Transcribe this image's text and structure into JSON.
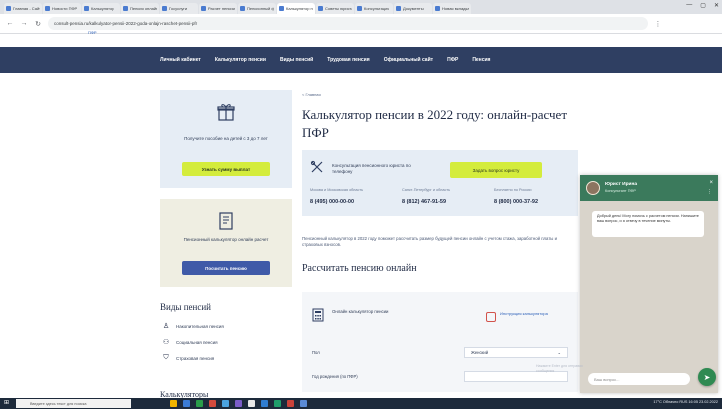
{
  "browser": {
    "tabs": [
      {
        "title": "Главная - Сайт"
      },
      {
        "title": "Новости ПФР"
      },
      {
        "title": "Калькулятор"
      },
      {
        "title": "Пенсия онлайн"
      },
      {
        "title": "Госуслуги"
      },
      {
        "title": "Расчет пенсии"
      },
      {
        "title": "Пенсионный фонд"
      },
      {
        "title": "Калькулятор пенсии",
        "active": true
      },
      {
        "title": "Советы юриста"
      },
      {
        "title": "Консультация"
      },
      {
        "title": "Документы"
      },
      {
        "title": "Новая вкладка"
      }
    ],
    "address": "consult-pensia.ru/kalkulyator-pensii-2022-goda-onlajn-raschet-pensii-pfr",
    "sub_url": "ПФР"
  },
  "site_nav": {
    "items": [
      "Личный кабинет",
      "Калькулятор пенсии",
      "Виды пенсий",
      "Трудовая пенсия",
      "Официальный сайт",
      "ПФР",
      "Пенсия"
    ]
  },
  "sidebar": {
    "card1": {
      "icon": "gift-icon",
      "text": "Получите пособие на детей с 3 до 7 лет",
      "button": "Узнать сумму выплат"
    },
    "card2": {
      "icon": "document-icon",
      "text": "Пенсионный калькулятор онлайн расчет",
      "button": "Посчитать пенсию"
    },
    "types_title": "Виды пенсий",
    "types": [
      {
        "icon": "person-icon",
        "label": "Накопительная пенсия"
      },
      {
        "icon": "people-icon",
        "label": "Социальная пенсия"
      },
      {
        "icon": "shield-icon",
        "label": "Страховая пенсия"
      }
    ],
    "bottom_title": "Калькуляторы"
  },
  "main": {
    "breadcrumb": "< Главная",
    "title": "Калькулятор пенсии в 2022 году: онлайн-расчет ПФР",
    "consult": {
      "icon": "tools-icon",
      "text": "Консультация пенсионного юриста по телефону",
      "button": "Задать вопрос юристу",
      "phones": [
        {
          "label": "Москва и Московская область",
          "number": "8 (495) 000-00-00"
        },
        {
          "label": "Санкт-Петербург и область",
          "number": "8 (812) 467-91-59"
        },
        {
          "label": "Бесплатно по России",
          "number": "8 (800) 000-37-92"
        }
      ]
    },
    "intro": "Пенсионный калькулятор в 2022 году поможет рассчитать размер будущей пенсии онлайн с учетом стажа, заработной платы и страховых взносов.",
    "calc_heading": "Рассчитать пенсию онлайн",
    "calc_panel": {
      "calc_text": "Онлайн калькулятор пенсии",
      "pdf_text": "Инструкция калькулятора",
      "fields": [
        {
          "label": "Пол",
          "value": "Женский"
        },
        {
          "label": "Год рождения (по ПФР)",
          "value": ""
        }
      ]
    }
  },
  "chat": {
    "name": "Юрист Ирина",
    "status": "Консультант ПФР",
    "message": "Добрый день! Могу помочь с расчетом пенсии. Напишите ваш вопрос, и я отвечу в течение минуты.",
    "input_placeholder": "Ваш вопрос...",
    "tip": "Нажмите Enter для отправки сообщения"
  },
  "taskbar": {
    "search_placeholder": "Введите здесь текст для поиска",
    "tray": "17°C Облачно  RUS  16:05  23.02.2022"
  },
  "colors": {
    "nav_bg": "#2f3f62",
    "accent_green": "#d4ec3c",
    "accent_blue": "#3f5aa8",
    "chat_green": "#3b7a5c"
  }
}
